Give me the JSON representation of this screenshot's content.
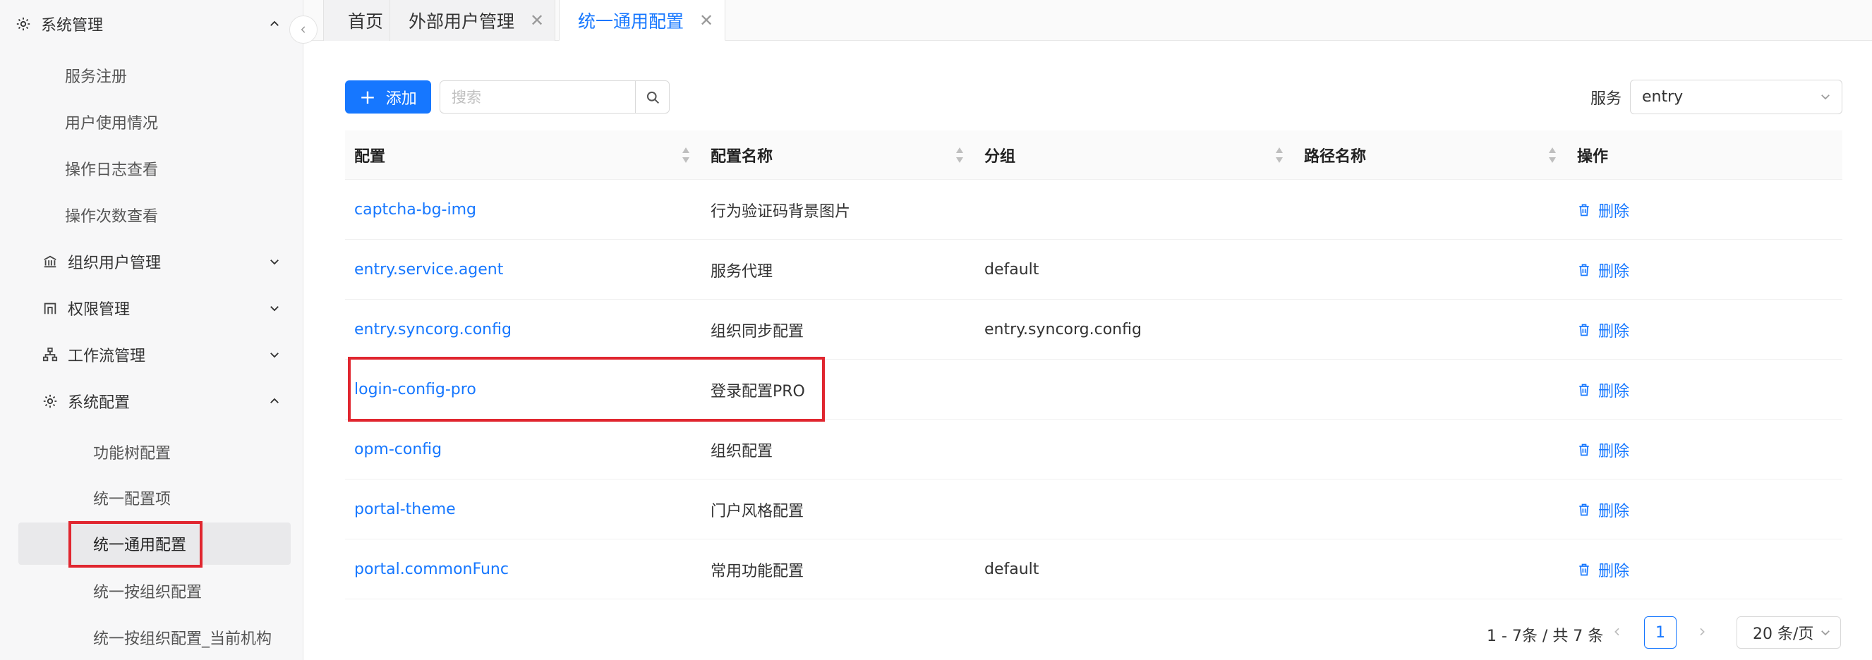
{
  "sidebar": {
    "top_title": "系统管理",
    "items_top": [
      "服务注册",
      "用户使用情况",
      "操作日志查看",
      "操作次数查看"
    ],
    "groups": [
      {
        "label": "组织用户管理",
        "icon": "bank-icon"
      },
      {
        "label": "权限管理",
        "icon": "permission-icon"
      },
      {
        "label": "工作流管理",
        "icon": "workflow-icon"
      },
      {
        "label": "系统配置",
        "icon": "gear-icon"
      }
    ],
    "config_items": [
      "功能树配置",
      "统一配置项",
      "统一通用配置",
      "统一按组织配置",
      "统一按组织配置_当前机构"
    ]
  },
  "tabs": [
    {
      "label": "首页",
      "active": false
    },
    {
      "label": "外部用户管理",
      "active": false,
      "closable": true
    },
    {
      "label": "统一通用配置",
      "active": true,
      "closable": true
    }
  ],
  "toolbar": {
    "add_label": "添加",
    "search_placeholder": "搜索",
    "service_label": "服务",
    "service_value": "entry"
  },
  "table": {
    "headers": [
      "配置",
      "配置名称",
      "分组",
      "路径名称",
      "操作"
    ],
    "rows": [
      {
        "key": "captcha-bg-img",
        "name": "行为验证码背景图片",
        "group": "",
        "path": ""
      },
      {
        "key": "entry.service.agent",
        "name": "服务代理",
        "group": "default",
        "path": ""
      },
      {
        "key": "entry.syncorg.config",
        "name": "组织同步配置",
        "group": "entry.syncorg.config",
        "path": ""
      },
      {
        "key": "login-config-pro",
        "name": "登录配置PRO",
        "group": "",
        "path": ""
      },
      {
        "key": "opm-config",
        "name": "组织配置",
        "group": "",
        "path": ""
      },
      {
        "key": "portal-theme",
        "name": "门户风格配置",
        "group": "",
        "path": ""
      },
      {
        "key": "portal.commonFunc",
        "name": "常用功能配置",
        "group": "default",
        "path": ""
      }
    ],
    "delete_label": "删除"
  },
  "pagination": {
    "total_text": "1 - 7条 / 共 7 条",
    "current_page": "1",
    "page_size": "20 条/页"
  },
  "colors": {
    "primary": "#1677ff",
    "highlight_box": "#e0262f"
  }
}
